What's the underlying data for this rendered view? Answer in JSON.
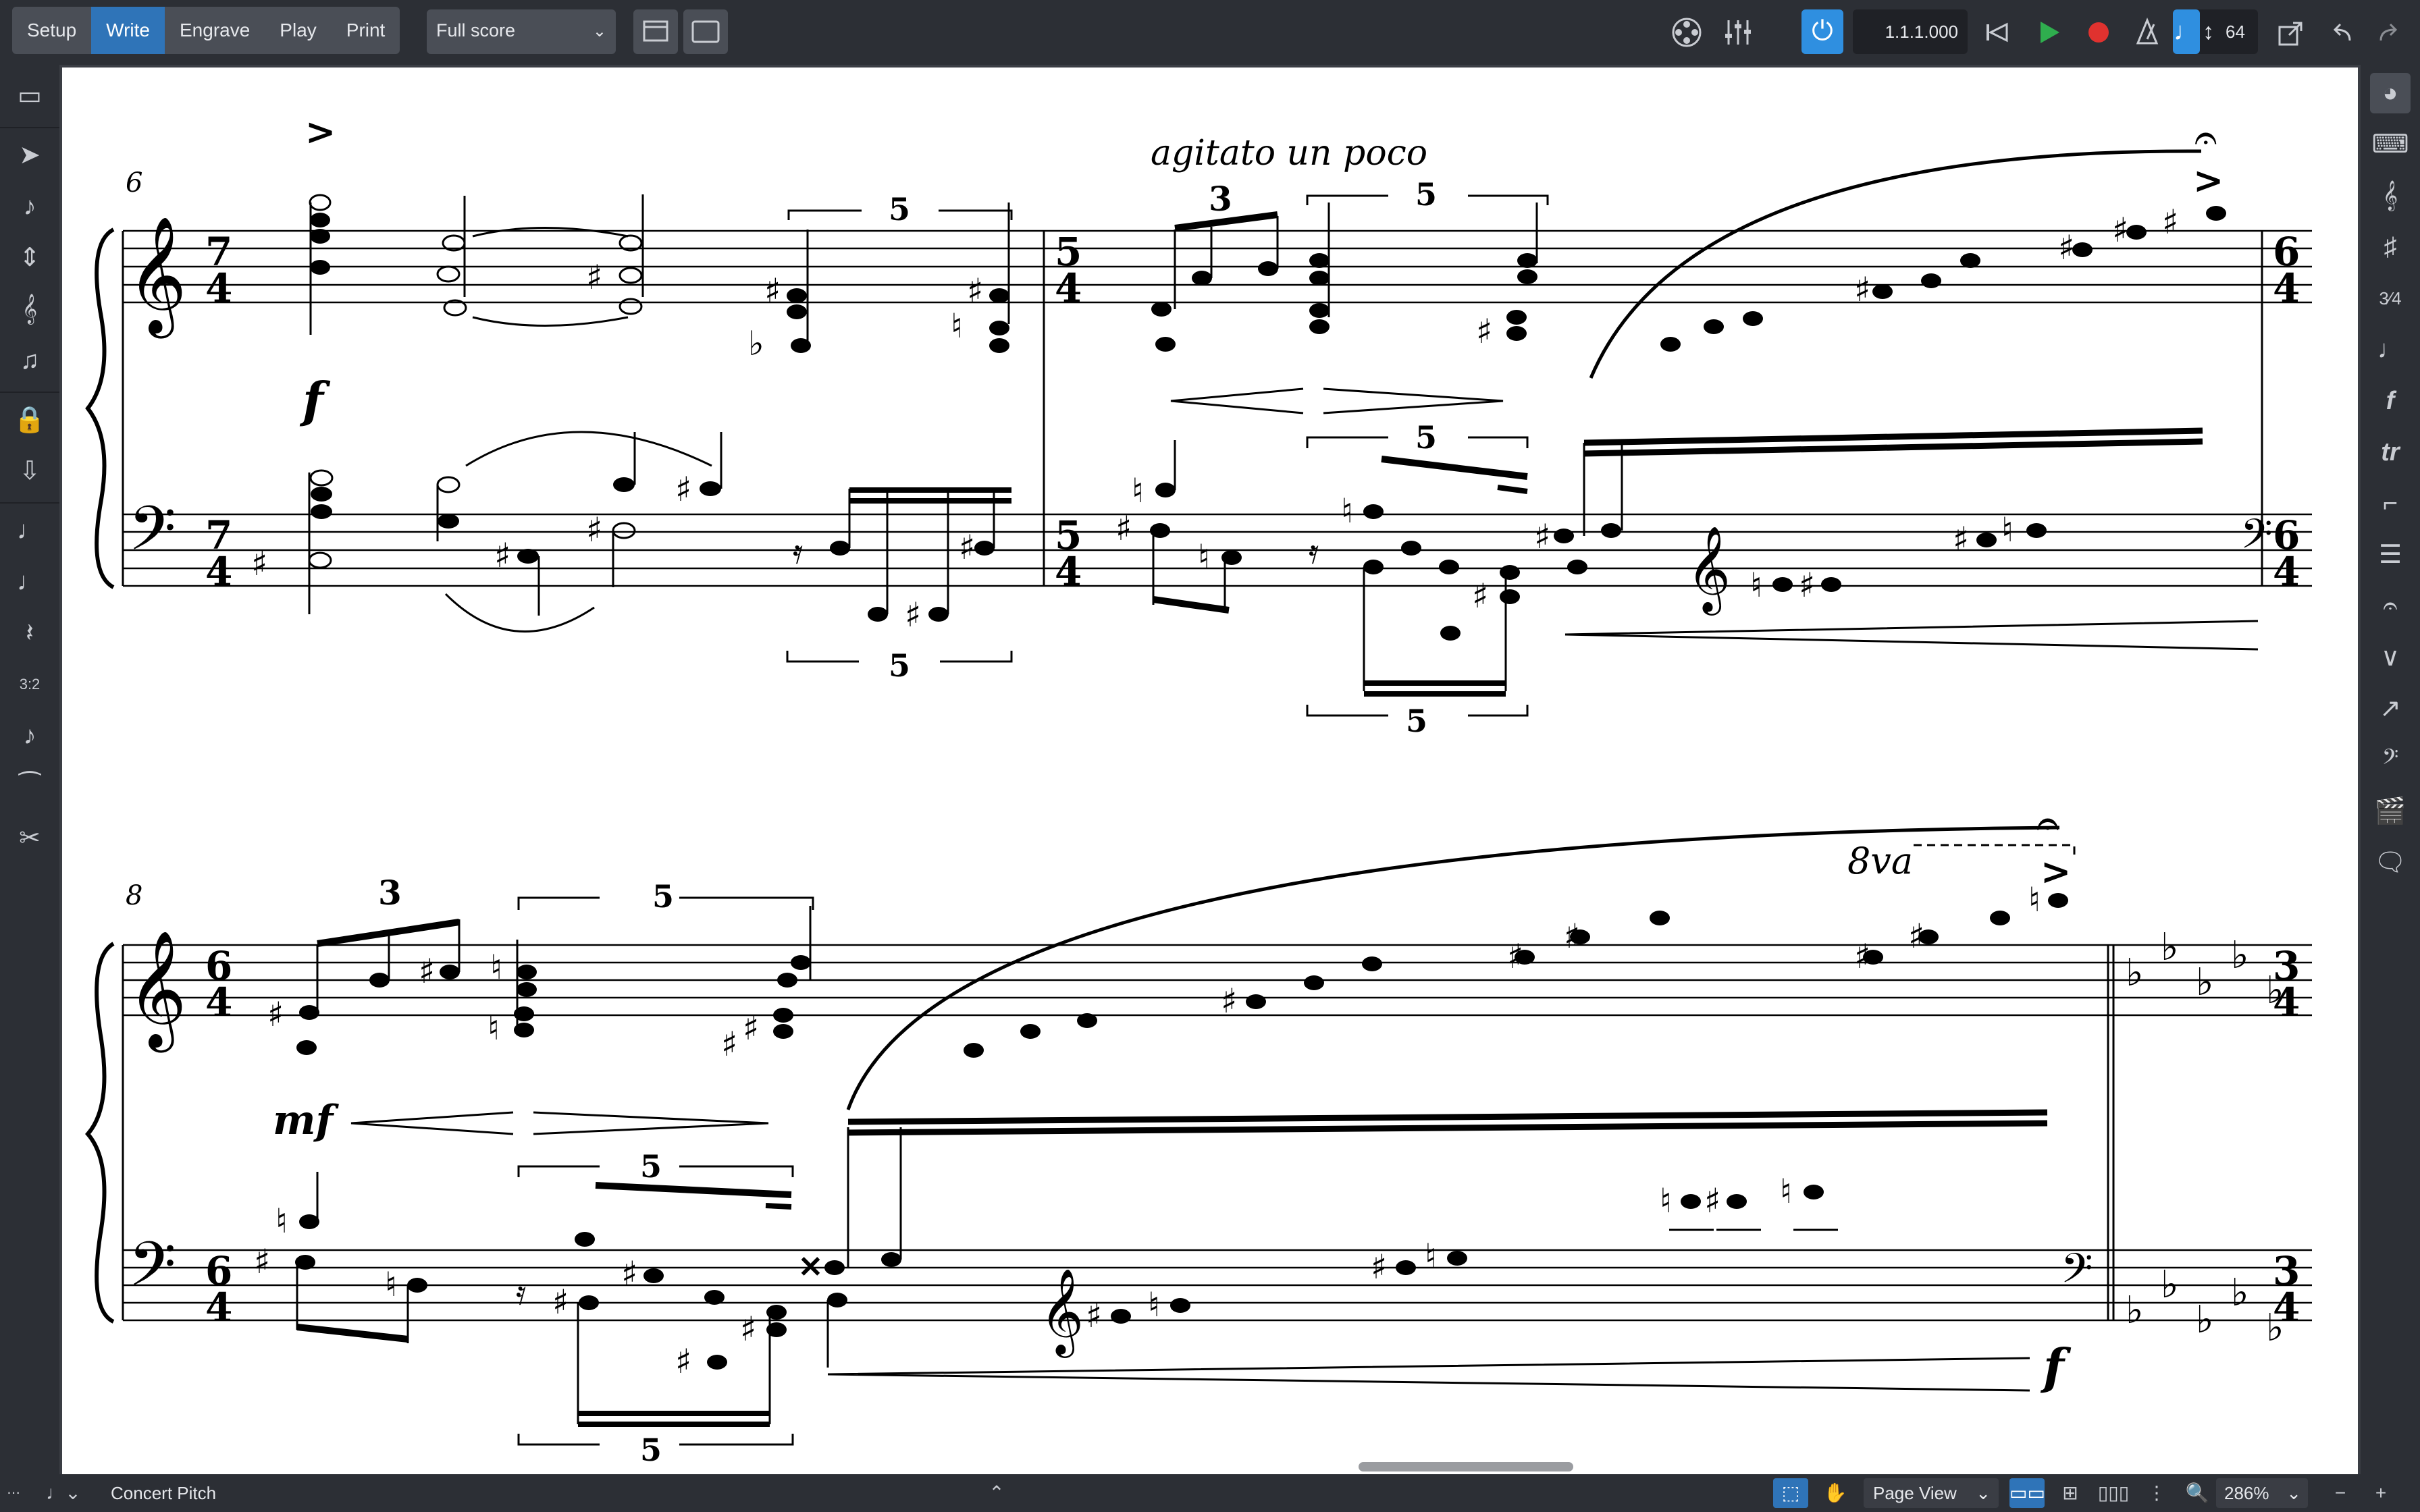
{
  "toolbar": {
    "modes": [
      "Setup",
      "Write",
      "Engrave",
      "Play",
      "Print"
    ],
    "active_mode": "Write",
    "layout": "Full score",
    "transport": {
      "position": "1.1.1.000",
      "tempo": "64"
    }
  },
  "score": {
    "system1": {
      "bar_number": "6",
      "expression": "agitato un poco",
      "dynamic": "f",
      "time_signatures": [
        "7/4",
        "5/4",
        "6/4"
      ],
      "tuplets": [
        "5",
        "3",
        "5",
        "5",
        "5",
        "5"
      ]
    },
    "system2": {
      "bar_number": "8",
      "dynamic_start": "mf",
      "dynamic_end": "f",
      "octave_line": "8va",
      "time_signatures": [
        "6/4",
        "3/4"
      ],
      "tuplets": [
        "3",
        "5",
        "5",
        "5"
      ]
    }
  },
  "statusbar": {
    "concert_pitch": "Concert Pitch",
    "view": "Page View",
    "zoom": "286%"
  },
  "colors": {
    "accent": "#2f74b8",
    "chrome": "#2c2f35",
    "paper": "#ffffff",
    "record": "#e0322f",
    "play": "#2fae4e"
  }
}
